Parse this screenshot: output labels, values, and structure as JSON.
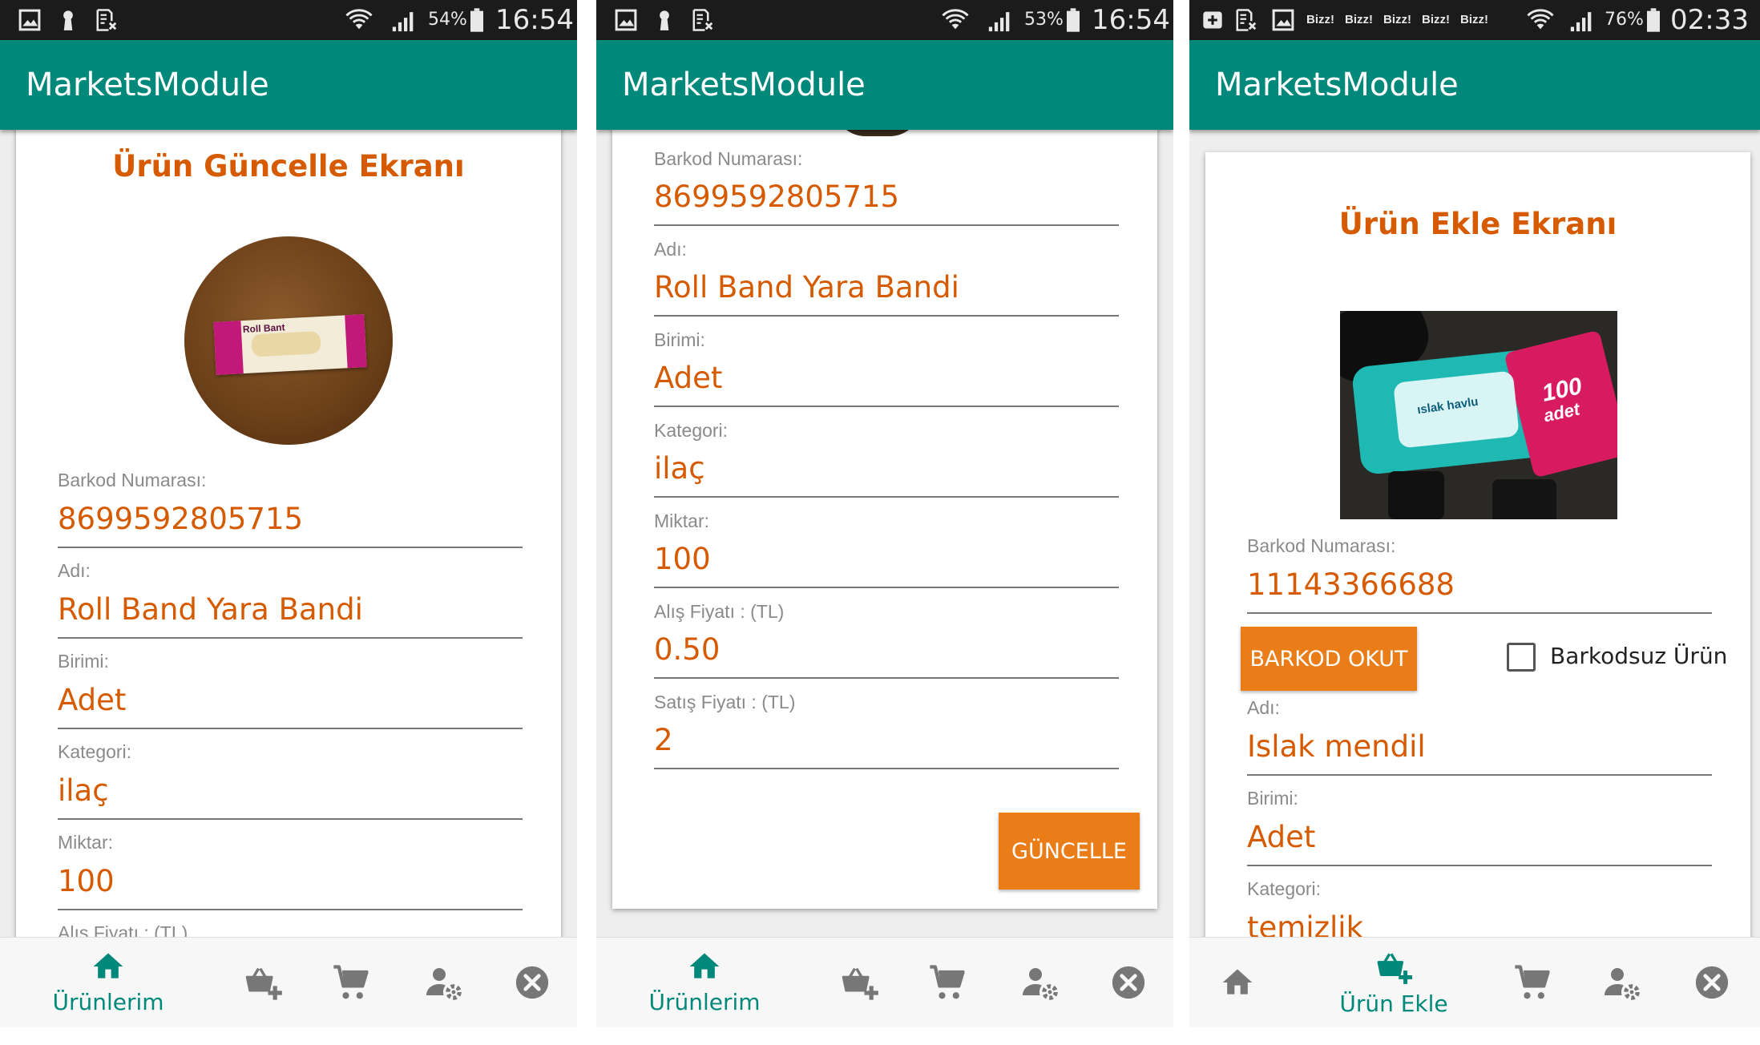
{
  "app": {
    "title": "MarketsModule"
  },
  "phones": [
    {
      "status": {
        "battery": "54%",
        "time": "16:54"
      },
      "screen_title": "Ürün Güncelle Ekranı",
      "fields": [
        {
          "label": "Barkod Numarası:",
          "value": "8699592805715"
        },
        {
          "label": "Adı:",
          "value": "Roll Band Yara Bandi"
        },
        {
          "label": "Birimi:",
          "value": "Adet"
        },
        {
          "label": "Kategori:",
          "value": "ilaç"
        },
        {
          "label": "Miktar:",
          "value": "100"
        },
        {
          "label": "Alış Fiyatı : (TL)",
          "value": ""
        }
      ],
      "nav": {
        "active_label": "Ürünlerim"
      }
    },
    {
      "status": {
        "battery": "53%",
        "time": "16:54"
      },
      "fields": [
        {
          "label": "Barkod Numarası:",
          "value": "8699592805715"
        },
        {
          "label": "Adı:",
          "value": "Roll Band Yara Bandi"
        },
        {
          "label": "Birimi:",
          "value": "Adet"
        },
        {
          "label": "Kategori:",
          "value": "ilaç"
        },
        {
          "label": "Miktar:",
          "value": "100"
        },
        {
          "label": "Alış Fiyatı : (TL)",
          "value": "0.50"
        },
        {
          "label": "Satış Fiyatı : (TL)",
          "value": "2"
        }
      ],
      "update_button": "GÜNCELLE",
      "nav": {
        "active_label": "Ürünlerim"
      }
    },
    {
      "status": {
        "battery": "76%",
        "time": "02:33",
        "notifications": [
          "Bizz!",
          "Bizz!",
          "Bizz!",
          "Bizz!",
          "Bizz!"
        ]
      },
      "screen_title": "Ürün Ekle Ekranı",
      "fields": [
        {
          "label": "Barkod Numarası:",
          "value": "11143366688"
        },
        {
          "label": "Adı:",
          "value": "Islak mendil"
        },
        {
          "label": "Birimi:",
          "value": "Adet"
        },
        {
          "label": "Kategori:",
          "value": "temizlik"
        }
      ],
      "scan_button": "BARKOD OKUT",
      "no_barcode_checkbox": {
        "label": "Barkodsuz Ürün",
        "checked": false
      },
      "product_photo_text": {
        "pack": "ıslak havlu",
        "count": "100",
        "unit": "adet"
      },
      "nav": {
        "active_label": "Ürün Ekle"
      }
    }
  ],
  "product_image_text": {
    "brand": "Roll Bant"
  },
  "nav_icons": [
    "home-icon",
    "basket-add-icon",
    "cart-icon",
    "user-settings-icon",
    "close-circle-icon"
  ],
  "colors": {
    "teal": "#00897b",
    "orange_text": "#d65a00",
    "orange_button": "#ea7d18",
    "status_bar": "#1b1b1b"
  }
}
